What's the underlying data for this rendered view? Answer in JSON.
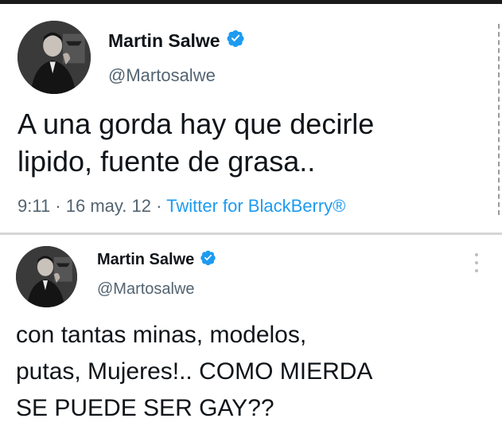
{
  "tweets": [
    {
      "author_name": "Martin Salwe",
      "handle": "@Martosalwe",
      "text": "A una gorda hay que decirle\nlipido, fuente de grasa..",
      "time": "9:11",
      "separator": " · ",
      "date": "16 may. 12",
      "source": "Twitter for BlackBerry®",
      "avatar_icon": "profile-photo",
      "verified_icon": "verified-badge-icon"
    },
    {
      "author_name": "Martin Salwe",
      "handle": "@Martosalwe",
      "text": "con tantas minas, modelos,\nputas, Mujeres!.. COMO MIERDA\nSE PUEDE SER GAY??",
      "avatar_icon": "profile-photo",
      "verified_icon": "verified-badge-icon",
      "more_icon": "more-vertical-icon"
    }
  ],
  "colors": {
    "text_primary": "#0f1419",
    "text_secondary": "#536471",
    "link": "#1d9bf0",
    "verified": "#1d9bf0"
  }
}
